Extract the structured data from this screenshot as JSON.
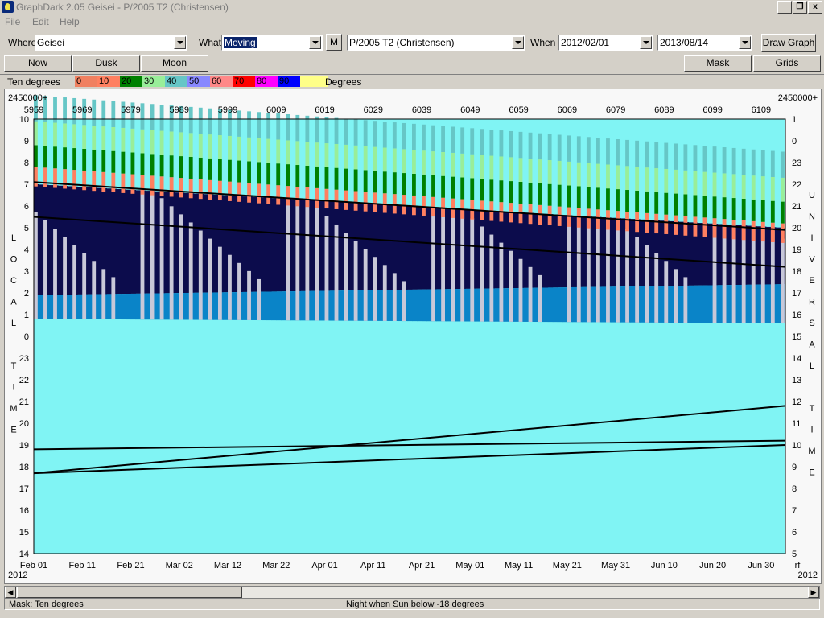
{
  "window": {
    "title": "GraphDark 2.05  Geisei  -  P/2005 T2 (Christensen)",
    "minimize_glyph": "_",
    "restore_glyph": "❐",
    "close_glyph": "x"
  },
  "menu": {
    "items": [
      "File",
      "Edit",
      "Help"
    ]
  },
  "toolbar": {
    "where_label": "Where",
    "where_value": "Geisei",
    "what_label": "What",
    "what_value": "Moving",
    "m_button": "M",
    "object_value": "P/2005 T2 (Christensen)",
    "when_label": "When",
    "date_start": "2012/02/01",
    "date_end": "2013/08/14",
    "draw_button": "Draw Graph"
  },
  "buttons": {
    "now": "Now",
    "dusk": "Dusk",
    "moon": "Moon",
    "mask": "Mask",
    "grids": "Grids"
  },
  "legend": {
    "label": "Ten degrees",
    "unit": "Degrees",
    "items": [
      {
        "label": "0",
        "color": "#f08060"
      },
      {
        "label": "10",
        "color": "#ff8060"
      },
      {
        "label": "20",
        "color": "#008000"
      },
      {
        "label": "30",
        "color": "#99ee99"
      },
      {
        "label": "40",
        "color": "#66c6c6"
      },
      {
        "label": "50",
        "color": "#8888ff"
      },
      {
        "label": "60",
        "color": "#ff8888"
      },
      {
        "label": "70",
        "color": "#ff0000"
      },
      {
        "label": "80",
        "color": "#ff00ff"
      },
      {
        "label": "90",
        "color": "#0000ff"
      },
      {
        "label": "",
        "color": "#ffff88"
      }
    ]
  },
  "graph": {
    "top_axis_prefix": "2450000+",
    "jd_ticks": [
      "5959",
      "5969",
      "5979",
      "5989",
      "5999",
      "6009",
      "6019",
      "6029",
      "6039",
      "6049",
      "6059",
      "6069",
      "6079",
      "6089",
      "6099",
      "6109"
    ],
    "date_ticks": [
      "Feb 01",
      "Feb 11",
      "Feb 21",
      "Mar 02",
      "Mar 12",
      "Mar 22",
      "Apr 01",
      "Apr 11",
      "Apr 21",
      "May 01",
      "May 11",
      "May 21",
      "May 31",
      "Jun 10",
      "Jun 20",
      "Jun 30"
    ],
    "year_left": "2012",
    "year_right": "2012",
    "bottom_right_mark": "rf",
    "left_ticks": [
      "10",
      "9",
      "8",
      "7",
      "6",
      "5",
      "4",
      "3",
      "2",
      "1",
      "0",
      "23",
      "22",
      "21",
      "20",
      "19",
      "18",
      "17",
      "16",
      "15",
      "14"
    ],
    "right_ticks": [
      "1",
      "0",
      "23",
      "22",
      "21",
      "20",
      "19",
      "18",
      "17",
      "16",
      "15",
      "14",
      "13",
      "12",
      "11",
      "10",
      "9",
      "8",
      "7",
      "6",
      "5"
    ],
    "left_axis_letters": [
      "L",
      "O",
      "C",
      "A",
      "L",
      "",
      "T",
      "I",
      "M",
      "E"
    ],
    "right_axis_letters": [
      "U",
      "N",
      "I",
      "V",
      "E",
      "R",
      "S",
      "A",
      "L",
      "",
      "T",
      "I",
      "M",
      "E"
    ],
    "colors": {
      "sky": "#80f4f4",
      "night": "#0c0c4c",
      "twilight": "#0a84c8",
      "moon": "#c8c8d8"
    }
  },
  "status": {
    "left": "Mask:  Ten degrees",
    "center": "Night when Sun below -18 degrees"
  }
}
